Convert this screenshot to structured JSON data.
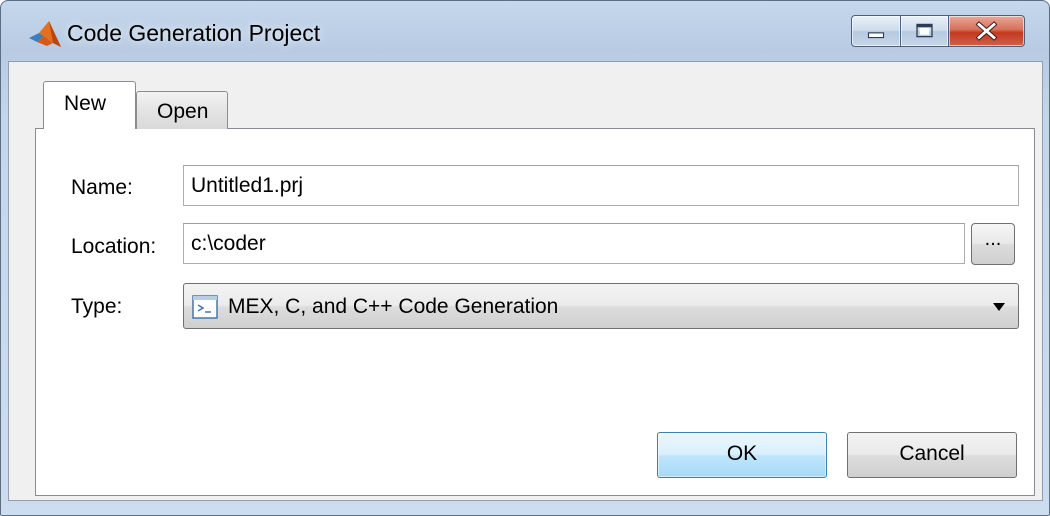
{
  "window": {
    "title": "Code Generation Project",
    "icon": "matlab-logo-icon",
    "controls": [
      "minimize-icon",
      "maximize-icon",
      "close-icon"
    ]
  },
  "tabs": [
    {
      "label": "New",
      "selected": true
    },
    {
      "label": "Open",
      "selected": false
    }
  ],
  "form": {
    "name_label": "Name:",
    "name_value": "Untitled1.prj",
    "location_label": "Location:",
    "location_value": "c:\\coder",
    "browse_label": "...",
    "type_label": "Type:",
    "type_value": "MEX, C, and C++ Code Generation",
    "type_icon": "project-type-icon"
  },
  "buttons": {
    "ok": "OK",
    "cancel": "Cancel"
  },
  "colors": {
    "titlebar": "#c5d7ec",
    "close_button": "#c4391f",
    "ok_border": "#3c7fb1"
  }
}
